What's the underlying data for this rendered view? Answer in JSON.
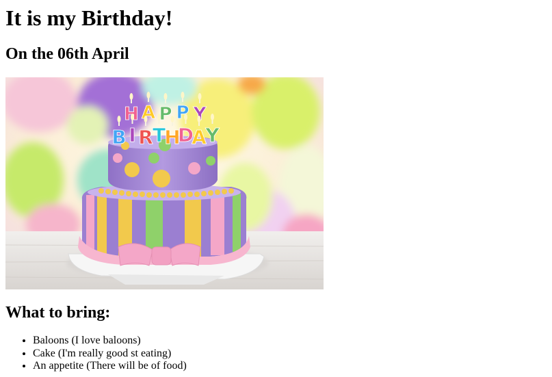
{
  "heading": "It is my Birthday!",
  "date": "On the 06th April",
  "image": {
    "alt": "Birthday cake",
    "candle_letters_top": [
      "H",
      "A",
      "P",
      "P",
      "Y"
    ],
    "candle_letters_bottom": [
      "B",
      "I",
      "R",
      "T",
      "H",
      "D",
      "A",
      "Y"
    ],
    "letter_colors": [
      "#f06292",
      "#ffca28",
      "#66bb6a",
      "#42a5f5",
      "#ab47bc",
      "#ef5350",
      "#26c6da",
      "#ffa726"
    ],
    "colors": {
      "top_tier": "#a98bd6",
      "bottom_tier_purple": "#9b7fd1",
      "stripe_yellow": "#f2c94c",
      "stripe_green": "#8fd16a",
      "stripe_pink": "#f4a7c8",
      "bow_pink": "#f7b6cf",
      "plate": "#f4f4f4",
      "table": "#e9e6e3"
    }
  },
  "bring": {
    "title": "What to bring:",
    "items": [
      "Baloons (I love baloons)",
      "Cake (I'm really good st eating)",
      "An appetite (There will be of food)"
    ]
  }
}
